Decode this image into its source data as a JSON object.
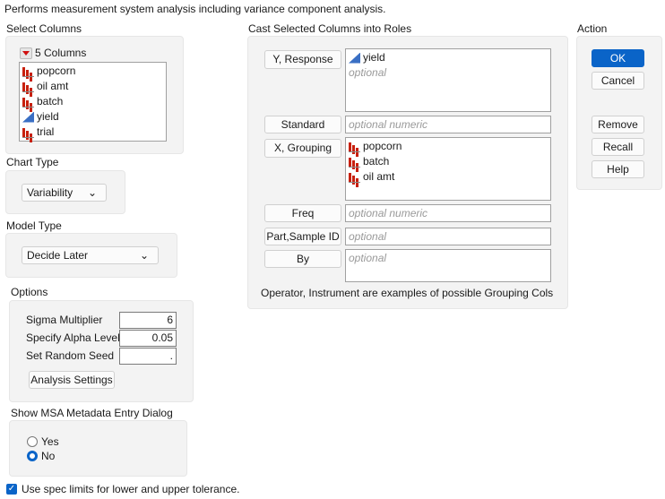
{
  "description": "Performs measurement system analysis including variance component analysis.",
  "select_columns": {
    "title": "Select Columns",
    "count_label": "5 Columns",
    "columns": [
      {
        "name": "popcorn",
        "type": "nominal"
      },
      {
        "name": "oil amt",
        "type": "nominal"
      },
      {
        "name": "batch",
        "type": "nominal"
      },
      {
        "name": "yield",
        "type": "continuous"
      },
      {
        "name": "trial",
        "type": "nominal"
      }
    ]
  },
  "chart_type": {
    "title": "Chart Type",
    "value": "Variability"
  },
  "model_type": {
    "title": "Model Type",
    "value": "Decide Later"
  },
  "options": {
    "title": "Options",
    "sigma_label": "Sigma Multiplier",
    "sigma_value": "6",
    "alpha_label": "Specify Alpha Level",
    "alpha_value": "0.05",
    "seed_label": "Set Random Seed",
    "seed_value": ".",
    "analysis_settings": "Analysis Settings"
  },
  "msa": {
    "title": "Show MSA Metadata Entry Dialog",
    "yes": "Yes",
    "no": "No",
    "selected": "No"
  },
  "spec_limits": {
    "label": "Use spec limits for lower and upper tolerance.",
    "checked": true
  },
  "cast": {
    "title": "Cast Selected Columns into Roles",
    "y": {
      "button": "Y, Response",
      "items": [
        "yield"
      ],
      "placeholder": "optional"
    },
    "standard": {
      "button": "Standard",
      "placeholder": "optional numeric"
    },
    "x": {
      "button": "X, Grouping",
      "items": [
        "popcorn",
        "batch",
        "oil amt"
      ]
    },
    "freq": {
      "button": "Freq",
      "placeholder": "optional numeric"
    },
    "part": {
      "button": "Part,Sample ID",
      "placeholder": "optional"
    },
    "by": {
      "button": "By",
      "placeholder": "optional"
    },
    "note": "Operator, Instrument are examples of possible Grouping Cols"
  },
  "action": {
    "title": "Action",
    "ok": "OK",
    "cancel": "Cancel",
    "remove": "Remove",
    "recall": "Recall",
    "help": "Help",
    "accent": "#0a64c8"
  }
}
